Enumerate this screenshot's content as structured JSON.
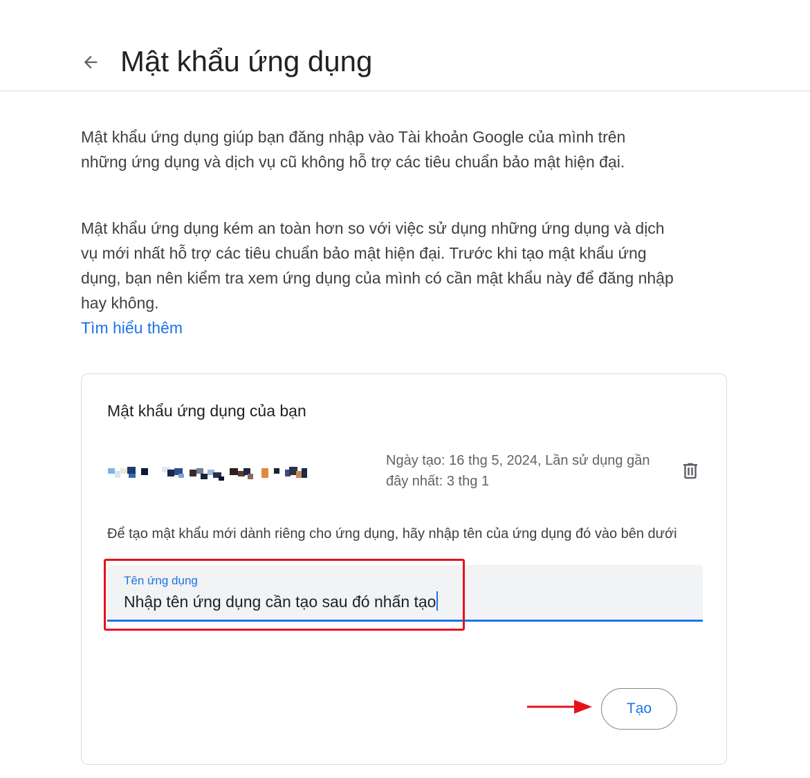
{
  "header": {
    "title": "Mật khẩu ứng dụng",
    "back_icon": "arrow-back-icon"
  },
  "description": {
    "paragraph1": "Mật khẩu ứng dụng giúp bạn đăng nhập vào Tài khoản Google của mình trên những ứng dụng và dịch vụ cũ không hỗ trợ các tiêu chuẩn bảo mật hiện đại.",
    "paragraph2": "Mật khẩu ứng dụng kém an toàn hơn so với việc sử dụng những ứng dụng và dịch vụ mới nhất hỗ trợ các tiêu chuẩn bảo mật hiện đại. Trước khi tạo mật khẩu ứng dụng, bạn nên kiểm tra xem ứng dụng của mình có cần mật khẩu này để đăng nhập hay không.",
    "learn_more": "Tìm hiểu thêm"
  },
  "card": {
    "title": "Mật khẩu ứng dụng của bạn",
    "existing_password": {
      "meta": "Ngày tạo: 16 thg 5, 2024, Lần sử dụng gần đây nhất: 3 thg 1",
      "delete_icon": "trash-icon"
    },
    "instruction": "Để tạo mật khẩu mới dành riêng cho ứng dụng, hãy nhập tên của ứng dụng đó vào bên dưới",
    "input": {
      "label": "Tên ứng dụng",
      "value": "Nhập tên ứng dụng cần tạo sau đó nhấn tạo"
    },
    "create_button": "Tạo"
  },
  "colors": {
    "accent": "#1a73e8",
    "annotation": "#e8101b",
    "field_background": "#f1f3f4",
    "title_text": "#202124",
    "body_text": "#3c4043",
    "meta_text": "#5f6368",
    "divider": "#dadce0"
  }
}
